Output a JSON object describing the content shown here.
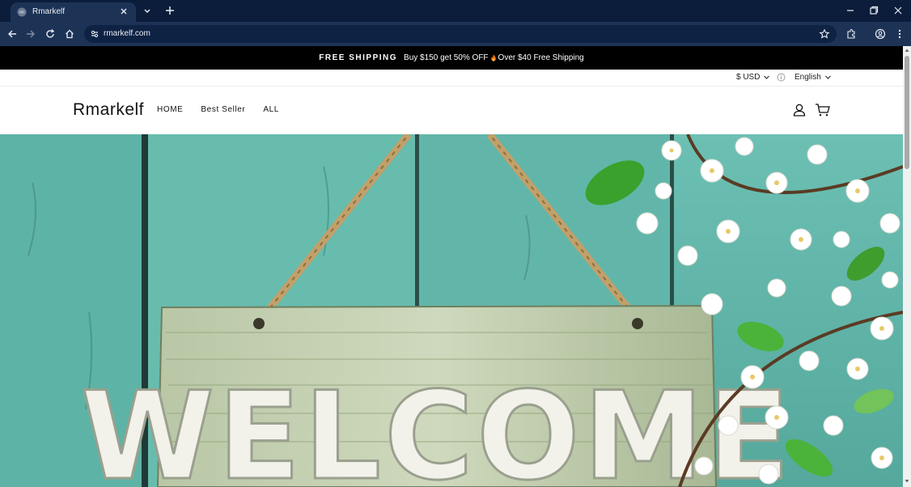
{
  "browser": {
    "tab_title": "Rmarkelf",
    "url": "rmarkelf.com"
  },
  "announcement": {
    "bold": "FREE SHIPPING",
    "text_before": "Buy $150 get 50% OFF",
    "text_after": "Over $40 Free Shipping"
  },
  "utility": {
    "currency": "$ USD",
    "language": "English"
  },
  "header": {
    "logo": "Rmarkelf",
    "nav": [
      "HOME",
      "Best Seller",
      "ALL"
    ]
  },
  "hero": {
    "sign_text": "WELCOME"
  },
  "colors": {
    "chrome_dark": "#0b1d3a",
    "chrome_toolbar": "#1d3356",
    "announce_bg": "#000000",
    "teal_wood": "#5fb5a9"
  },
  "icons": [
    "site-favicon",
    "close-icon",
    "chevron-down-icon",
    "plus-icon",
    "minimize-icon",
    "restore-icon",
    "back-icon",
    "forward-icon",
    "reload-icon",
    "home-icon",
    "site-info-icon",
    "star-icon",
    "extensions-icon",
    "profile-icon",
    "more-icon",
    "fire-icon",
    "info-icon",
    "account-icon",
    "cart-icon"
  ]
}
